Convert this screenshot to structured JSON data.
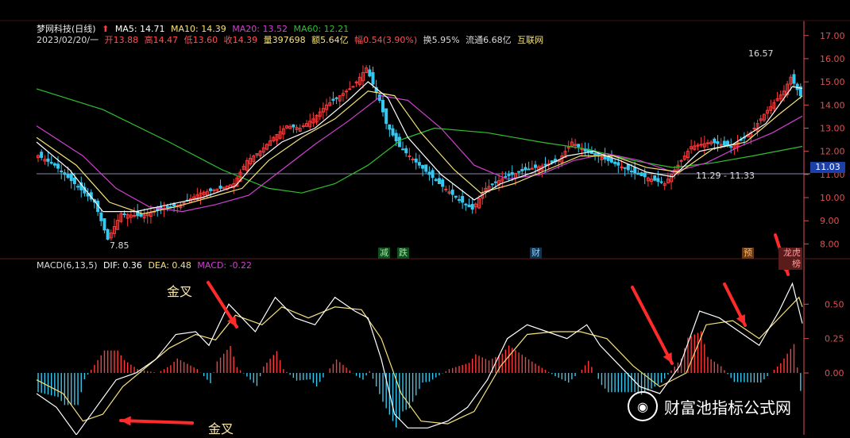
{
  "header": {
    "stock_name": "梦网科技(日线)",
    "ma5": "MA5: 14.71",
    "ma10": "MA10: 14.39",
    "ma20": "MA20: 13.52",
    "ma60": "MA60: 12.21",
    "date": "2023/02/20/一",
    "open": "开13.88",
    "high": "高14.47",
    "low": "低13.60",
    "close": "收14.39",
    "volume": "量397698",
    "amount": "额5.64亿",
    "change": "幅0.54(3.90%)",
    "turnover": "换5.95%",
    "float": "流通6.68亿",
    "sector": "互联网"
  },
  "macd_header": {
    "name": "MACD(6,13,5)",
    "dif": "DIF: 0.36",
    "dea": "DEA: 0.48",
    "macd": "MACD: -0.22"
  },
  "annotations": {
    "golden_cross_1": "金叉",
    "golden_cross_2": "金叉",
    "low_label": "7.85",
    "high_label": "16.57",
    "range_label": "11.29 - 11.33",
    "current_price": "11.03"
  },
  "events": [
    "减",
    "跌",
    "财",
    "预",
    "龙虎榜"
  ],
  "watermark": "财富池指标公式网",
  "colors": {
    "up": "#ff3b3b",
    "down": "#36c8f0",
    "ma5": "#ffffff",
    "ma10": "#f5e27a",
    "ma20": "#d040d0",
    "ma60": "#30c030",
    "axis": "#e05050"
  },
  "chart_data": {
    "type": "candlestick",
    "price_axis": {
      "ticks": [
        8.0,
        9.0,
        10.0,
        11.0,
        12.0,
        13.0,
        14.0,
        15.0,
        16.0,
        17.0
      ],
      "range": [
        7.5,
        17.3
      ]
    },
    "macd_axis": {
      "ticks": [
        0.0,
        0.25,
        0.5
      ],
      "range": [
        -0.45,
        0.75
      ]
    },
    "close_trend": [
      [
        0,
        11.9
      ],
      [
        6,
        11.4
      ],
      [
        12,
        10.6
      ],
      [
        18,
        9.8
      ],
      [
        22,
        8.2
      ],
      [
        26,
        9.3
      ],
      [
        32,
        9.2
      ],
      [
        38,
        9.5
      ],
      [
        44,
        9.7
      ],
      [
        50,
        10.2
      ],
      [
        56,
        10.4
      ],
      [
        60,
        10.6
      ],
      [
        64,
        11.6
      ],
      [
        68,
        12.0
      ],
      [
        72,
        12.6
      ],
      [
        76,
        13.1
      ],
      [
        80,
        13.0
      ],
      [
        84,
        13.4
      ],
      [
        88,
        14.0
      ],
      [
        92,
        14.4
      ],
      [
        96,
        14.8
      ],
      [
        100,
        15.6
      ],
      [
        104,
        14.2
      ],
      [
        106,
        13.2
      ],
      [
        110,
        12.2
      ],
      [
        116,
        11.4
      ],
      [
        122,
        10.6
      ],
      [
        128,
        9.9
      ],
      [
        132,
        9.5
      ],
      [
        136,
        10.4
      ],
      [
        142,
        10.9
      ],
      [
        148,
        11.2
      ],
      [
        154,
        11.4
      ],
      [
        158,
        11.6
      ],
      [
        162,
        12.4
      ],
      [
        166,
        12.0
      ],
      [
        170,
        11.8
      ],
      [
        176,
        11.4
      ],
      [
        182,
        11.0
      ],
      [
        186,
        10.8
      ],
      [
        190,
        10.6
      ],
      [
        194,
        11.4
      ],
      [
        198,
        12.2
      ],
      [
        204,
        12.4
      ],
      [
        210,
        12.2
      ],
      [
        216,
        12.8
      ],
      [
        220,
        13.6
      ],
      [
        226,
        14.6
      ],
      [
        228,
        15.2
      ],
      [
        231,
        14.4
      ]
    ],
    "ma5": [
      [
        0,
        12.4
      ],
      [
        10,
        11.2
      ],
      [
        20,
        9.4
      ],
      [
        30,
        9.4
      ],
      [
        40,
        9.7
      ],
      [
        50,
        10.0
      ],
      [
        60,
        10.5
      ],
      [
        66,
        11.5
      ],
      [
        74,
        12.4
      ],
      [
        84,
        13.0
      ],
      [
        94,
        14.2
      ],
      [
        100,
        15.0
      ],
      [
        106,
        14.3
      ],
      [
        112,
        12.6
      ],
      [
        122,
        11.0
      ],
      [
        132,
        9.9
      ],
      [
        140,
        10.6
      ],
      [
        150,
        11.1
      ],
      [
        160,
        11.8
      ],
      [
        168,
        12.0
      ],
      [
        176,
        11.6
      ],
      [
        184,
        11.1
      ],
      [
        192,
        10.9
      ],
      [
        200,
        12.0
      ],
      [
        210,
        12.3
      ],
      [
        220,
        13.2
      ],
      [
        228,
        14.8
      ],
      [
        231,
        14.71
      ]
    ],
    "ma10": [
      [
        0,
        12.6
      ],
      [
        12,
        11.4
      ],
      [
        22,
        9.8
      ],
      [
        32,
        9.3
      ],
      [
        42,
        9.6
      ],
      [
        52,
        10.0
      ],
      [
        62,
        10.4
      ],
      [
        70,
        11.6
      ],
      [
        80,
        12.6
      ],
      [
        90,
        13.4
      ],
      [
        100,
        14.6
      ],
      [
        108,
        14.4
      ],
      [
        116,
        12.8
      ],
      [
        126,
        11.2
      ],
      [
        134,
        10.2
      ],
      [
        144,
        10.6
      ],
      [
        154,
        11.2
      ],
      [
        164,
        11.8
      ],
      [
        174,
        11.8
      ],
      [
        184,
        11.3
      ],
      [
        194,
        11.1
      ],
      [
        204,
        12.1
      ],
      [
        214,
        12.4
      ],
      [
        224,
        13.6
      ],
      [
        231,
        14.39
      ]
    ],
    "ma20": [
      [
        0,
        13.1
      ],
      [
        14,
        11.8
      ],
      [
        24,
        10.4
      ],
      [
        34,
        9.6
      ],
      [
        44,
        9.4
      ],
      [
        54,
        9.7
      ],
      [
        64,
        10.1
      ],
      [
        74,
        11.2
      ],
      [
        84,
        12.3
      ],
      [
        94,
        13.3
      ],
      [
        104,
        14.4
      ],
      [
        112,
        14.2
      ],
      [
        122,
        13.0
      ],
      [
        132,
        11.4
      ],
      [
        142,
        10.8
      ],
      [
        152,
        11.0
      ],
      [
        162,
        11.6
      ],
      [
        172,
        11.9
      ],
      [
        182,
        11.6
      ],
      [
        192,
        11.1
      ],
      [
        202,
        11.5
      ],
      [
        212,
        12.2
      ],
      [
        222,
        12.8
      ],
      [
        231,
        13.52
      ]
    ],
    "ma60": [
      [
        0,
        14.7
      ],
      [
        20,
        13.8
      ],
      [
        40,
        12.4
      ],
      [
        56,
        11.2
      ],
      [
        70,
        10.4
      ],
      [
        80,
        10.2
      ],
      [
        90,
        10.6
      ],
      [
        100,
        11.4
      ],
      [
        110,
        12.5
      ],
      [
        120,
        13.0
      ],
      [
        136,
        12.8
      ],
      [
        152,
        12.4
      ],
      [
        166,
        12.1
      ],
      [
        180,
        11.6
      ],
      [
        192,
        11.3
      ],
      [
        204,
        11.5
      ],
      [
        216,
        11.8
      ],
      [
        231,
        12.21
      ]
    ],
    "dif": [
      [
        0,
        -0.15
      ],
      [
        6,
        -0.25
      ],
      [
        12,
        -0.45
      ],
      [
        18,
        -0.25
      ],
      [
        24,
        -0.05
      ],
      [
        30,
        0.0
      ],
      [
        36,
        0.1
      ],
      [
        42,
        0.28
      ],
      [
        48,
        0.3
      ],
      [
        52,
        0.2
      ],
      [
        58,
        0.5
      ],
      [
        62,
        0.4
      ],
      [
        66,
        0.3
      ],
      [
        72,
        0.55
      ],
      [
        78,
        0.4
      ],
      [
        84,
        0.35
      ],
      [
        90,
        0.55
      ],
      [
        96,
        0.45
      ],
      [
        100,
        0.4
      ],
      [
        104,
        0.1
      ],
      [
        108,
        -0.3
      ],
      [
        112,
        -0.4
      ],
      [
        118,
        -0.4
      ],
      [
        124,
        -0.35
      ],
      [
        130,
        -0.25
      ],
      [
        136,
        -0.05
      ],
      [
        142,
        0.25
      ],
      [
        148,
        0.35
      ],
      [
        154,
        0.3
      ],
      [
        160,
        0.25
      ],
      [
        166,
        0.35
      ],
      [
        170,
        0.2
      ],
      [
        176,
        0.05
      ],
      [
        182,
        -0.1
      ],
      [
        188,
        -0.15
      ],
      [
        194,
        0.05
      ],
      [
        200,
        0.45
      ],
      [
        206,
        0.4
      ],
      [
        212,
        0.3
      ],
      [
        218,
        0.2
      ],
      [
        224,
        0.45
      ],
      [
        228,
        0.65
      ],
      [
        231,
        0.36
      ]
    ],
    "dea": [
      [
        0,
        -0.05
      ],
      [
        8,
        -0.15
      ],
      [
        14,
        -0.35
      ],
      [
        20,
        -0.3
      ],
      [
        26,
        -0.1
      ],
      [
        32,
        0.02
      ],
      [
        40,
        0.18
      ],
      [
        48,
        0.28
      ],
      [
        54,
        0.24
      ],
      [
        60,
        0.42
      ],
      [
        68,
        0.35
      ],
      [
        74,
        0.48
      ],
      [
        82,
        0.4
      ],
      [
        90,
        0.48
      ],
      [
        98,
        0.46
      ],
      [
        104,
        0.25
      ],
      [
        110,
        -0.15
      ],
      [
        116,
        -0.35
      ],
      [
        124,
        -0.37
      ],
      [
        132,
        -0.28
      ],
      [
        140,
        0.05
      ],
      [
        148,
        0.28
      ],
      [
        156,
        0.3
      ],
      [
        164,
        0.3
      ],
      [
        172,
        0.25
      ],
      [
        180,
        0.05
      ],
      [
        188,
        -0.1
      ],
      [
        196,
        0.0
      ],
      [
        202,
        0.35
      ],
      [
        210,
        0.38
      ],
      [
        218,
        0.25
      ],
      [
        226,
        0.45
      ],
      [
        230,
        0.55
      ],
      [
        231,
        0.48
      ]
    ]
  }
}
